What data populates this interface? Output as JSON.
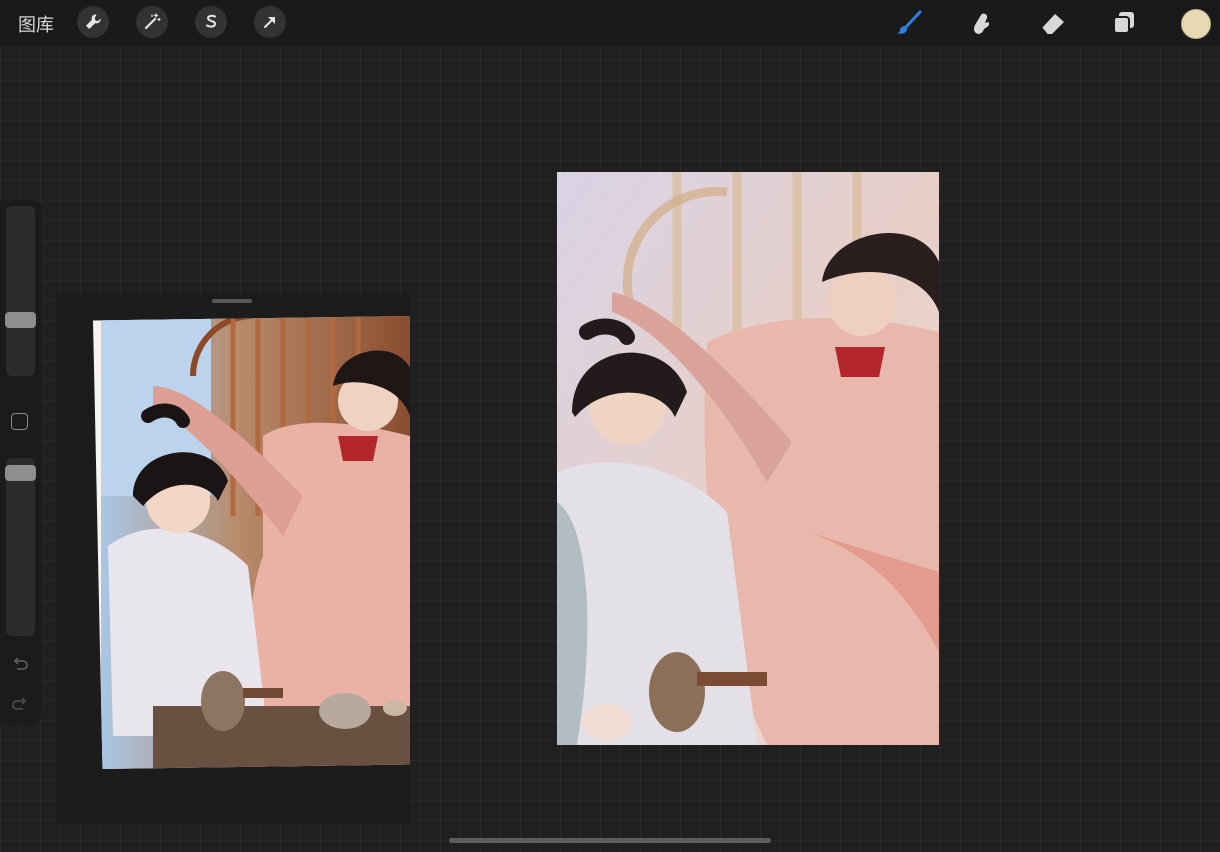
{
  "toolbar": {
    "gallery_label": "图库",
    "left_tools": [
      "wrench-icon",
      "magic-wand-icon",
      "selection-s-icon",
      "transform-arrow-icon"
    ],
    "right_tools": [
      "brush-icon",
      "smudge-icon",
      "eraser-icon",
      "layers-icon"
    ],
    "active_tool": "brush-icon",
    "active_color": "#e7d9b2",
    "accent_color": "#2f7fe0"
  },
  "sidebar": {
    "brush_size_level": 0.27,
    "opacity_level": 0.05
  }
}
